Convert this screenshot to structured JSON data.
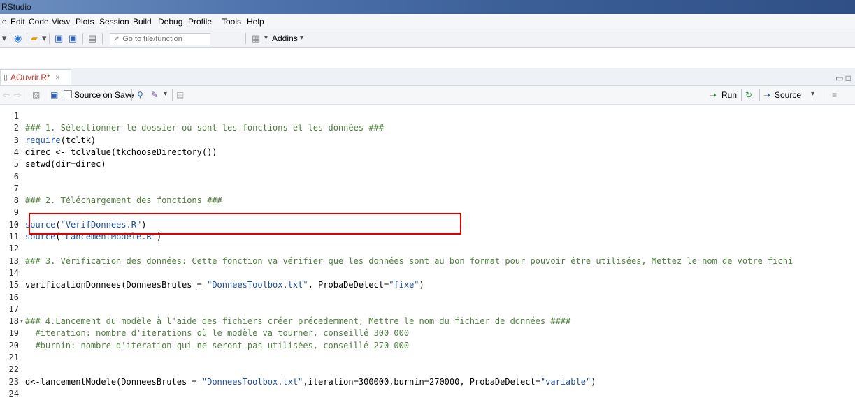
{
  "window": {
    "title": "RStudio"
  },
  "menu": [
    "e",
    "Edit",
    "Code",
    "View",
    "Plots",
    "Session",
    "Build",
    "Debug",
    "Profile",
    "Tools",
    "Help"
  ],
  "toolbar": {
    "goto_placeholder": "Go to file/function",
    "addins_label": "Addins"
  },
  "tab": {
    "file_name": "AOuvrir.R*",
    "close_glyph": "×"
  },
  "editor_toolbar": {
    "source_on_save_label": "Source on Save",
    "run_label": "Run",
    "source_label": "Source"
  },
  "code_lines": [
    {
      "n": "1",
      "t": ""
    },
    {
      "n": "2",
      "t": "### 1. Sélectionner le dossier où sont les fonctions et les données ###"
    },
    {
      "n": "3",
      "t": "require(tcltk)"
    },
    {
      "n": "4",
      "t": "direc <- tclvalue(tkchooseDirectory())"
    },
    {
      "n": "5",
      "t": "setwd(dir=direc)"
    },
    {
      "n": "6",
      "t": ""
    },
    {
      "n": "7",
      "t": ""
    },
    {
      "n": "8",
      "t": "### 2. Téléchargement des fonctions ###"
    },
    {
      "n": "9",
      "t": ""
    },
    {
      "n": "10",
      "t": "source(\"VerifDonnees.R\")"
    },
    {
      "n": "11",
      "t": "source(\"LancementModele.R\")"
    },
    {
      "n": "12",
      "t": ""
    },
    {
      "n": "13",
      "t": "### 3. Vérification des données: Cette fonction va vérifier que les données sont au bon format pour pouvoir être utilisées, Mettez le nom de votre fichi"
    },
    {
      "n": "14",
      "t": ""
    },
    {
      "n": "15",
      "t": "verificationDonnees(DonneesBrutes = \"DonneesToolbox.txt\", ProbaDeDetect=\"fixe\")"
    },
    {
      "n": "16",
      "t": ""
    },
    {
      "n": "17",
      "t": ""
    },
    {
      "n": "18",
      "t": "### 4.Lancement du modèle à l'aide des fichiers créer précedemment, Mettre le nom du fichier de données ####"
    },
    {
      "n": "19",
      "t": "  #iteration: nombre d'iterations où le modèle va tourner, conseillé 300 000"
    },
    {
      "n": "20",
      "t": "  #burnin: nombre d'iteration qui ne seront pas utilisées, conseillé 270 000"
    },
    {
      "n": "21",
      "t": ""
    },
    {
      "n": "22",
      "t": ""
    },
    {
      "n": "23",
      "t": "d<-lancementModele(DonneesBrutes = \"DonneesToolbox.txt\",iteration=300000,burnin=270000, ProbaDeDetect=\"variable\")"
    },
    {
      "n": "24",
      "t": ""
    }
  ],
  "line_kinds": [
    "blank",
    "comment",
    "code",
    "code",
    "code",
    "blank",
    "blank",
    "comment",
    "blank",
    "code",
    "code",
    "blank",
    "comment",
    "blank",
    "code",
    "blank",
    "blank",
    "comment",
    "comment",
    "comment",
    "blank",
    "blank",
    "code",
    "blank"
  ],
  "fold_marker": "▾",
  "colors": {
    "comment": "#4f7f3f",
    "keyword": "#2255aa",
    "highlight_box": "#e00000"
  }
}
